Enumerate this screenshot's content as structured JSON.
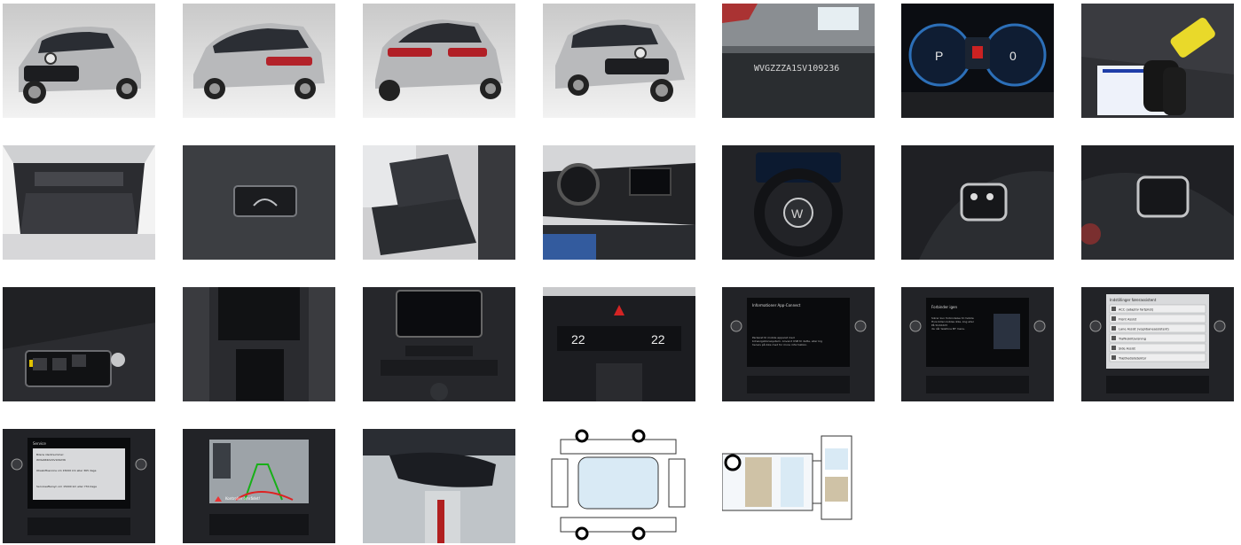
{
  "gallery": {
    "photos": [
      {
        "kind": "car-front",
        "alt": ""
      },
      {
        "kind": "car-rear-side",
        "alt": ""
      },
      {
        "kind": "car-rear",
        "alt": ""
      },
      {
        "kind": "car-front-right",
        "alt": ""
      },
      {
        "kind": "vin-windshield",
        "alt": ""
      },
      {
        "kind": "instrument-cluster",
        "alt": ""
      },
      {
        "kind": "keys",
        "alt": ""
      },
      {
        "kind": "trunk",
        "alt": ""
      },
      {
        "kind": "trunk-button",
        "alt": ""
      },
      {
        "kind": "rear-seats",
        "alt": ""
      },
      {
        "kind": "dashboard-side",
        "alt": ""
      },
      {
        "kind": "steering-wheel",
        "alt": ""
      },
      {
        "kind": "steering-controls-left",
        "alt": ""
      },
      {
        "kind": "steering-controls-right",
        "alt": ""
      },
      {
        "kind": "door-window-switches",
        "alt": ""
      },
      {
        "kind": "center-console",
        "alt": ""
      },
      {
        "kind": "center-stack",
        "alt": ""
      },
      {
        "kind": "climate-controls",
        "alt": ""
      },
      {
        "kind": "infotainment-app-connect",
        "alt": ""
      },
      {
        "kind": "infotainment-pairing",
        "alt": ""
      },
      {
        "kind": "infotainment-settings",
        "alt": ""
      },
      {
        "kind": "infotainment-service",
        "alt": ""
      },
      {
        "kind": "rear-camera",
        "alt": ""
      },
      {
        "kind": "rearview-mirror",
        "alt": ""
      },
      {
        "kind": "damage-diagram-exterior",
        "alt": ""
      },
      {
        "kind": "damage-diagram-interior",
        "alt": ""
      }
    ],
    "texts": {
      "vin": "WVGZZZA1SV109236",
      "cluster_left": "P",
      "cluster_right": "0",
      "temp_left": "22",
      "temp_right": "22",
      "app_connect_title": "Informationer App-Connect",
      "app_connect_body": "Parkeret til mobile apparat med\nbilnavigationssystem. Anvend USB til dette, eller kig\nhenvis på ikke med for more information.",
      "pairing_title": "Forbinder igen",
      "pairing_body": "Sikrer kun forbindelse til mobile\nHvis billen kobles ikke, kog eller\nPå SV10223\nda når telefone BT menu.",
      "settings_title": "Indstillinger førerassistent",
      "settings_items": [
        "ACC (adaptiv fartpilot)",
        "Front Assist",
        "Lane Assist (vognbaneassistent)",
        "Trafikskiltsvisning",
        "Side Assist",
        "Træthedsdetektor"
      ],
      "service_title": "Service",
      "service_line1": "Bilens identnummer:",
      "service_line2": "WVGZZZA1SV109236",
      "service_line3": "Olieskiftservice om 15000 km eller 365 dage",
      "service_line4": "Serviceeftersyn om 15000 km eller 730 dage",
      "camera_warning": "Kontroller området!"
    }
  }
}
